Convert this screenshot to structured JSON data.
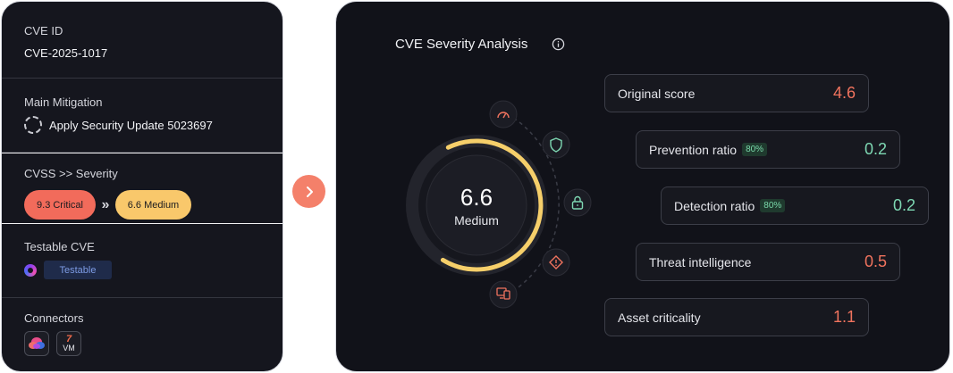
{
  "left": {
    "cve_label": "CVE ID",
    "cve_id": "CVE-2025-1017",
    "mitigation_label": "Main Mitigation",
    "mitigation_value": "Apply Security Update 5023697",
    "cvss_label": "CVSS >> Severity",
    "severity_from": "9.3 Critical",
    "severity_to": "6.6 Medium",
    "testable_label": "Testable CVE",
    "testable_badge": "Testable",
    "connectors_label": "Connectors",
    "connector_vm_glyph": "7",
    "connector_vm_text": "VM"
  },
  "right": {
    "title": "CVE Severity Analysis",
    "score": "6.6",
    "score_label": "Medium",
    "gauge_fraction": 0.66,
    "cards": [
      {
        "label": "Original score",
        "value": "4.6",
        "tone": "red"
      },
      {
        "label": "Prevention ratio",
        "badge": "80%",
        "value": "0.2",
        "tone": "green"
      },
      {
        "label": "Detection ratio",
        "badge": "80%",
        "value": "0.2",
        "tone": "green"
      },
      {
        "label": "Threat intelligence",
        "value": "0.5",
        "tone": "red"
      },
      {
        "label": "Asset criticality",
        "value": "1.1",
        "tone": "red"
      }
    ],
    "node_icons": [
      "gauge-icon",
      "shield-icon",
      "lock-icon",
      "warning-diamond-icon",
      "devices-icon"
    ]
  },
  "colors": {
    "accent_red": "#f0735e",
    "accent_green": "#7ed8b3",
    "gauge_yellow": "#f6cf6a",
    "critical_pill": "#f26b5b",
    "medium_pill": "#f9c86b"
  }
}
